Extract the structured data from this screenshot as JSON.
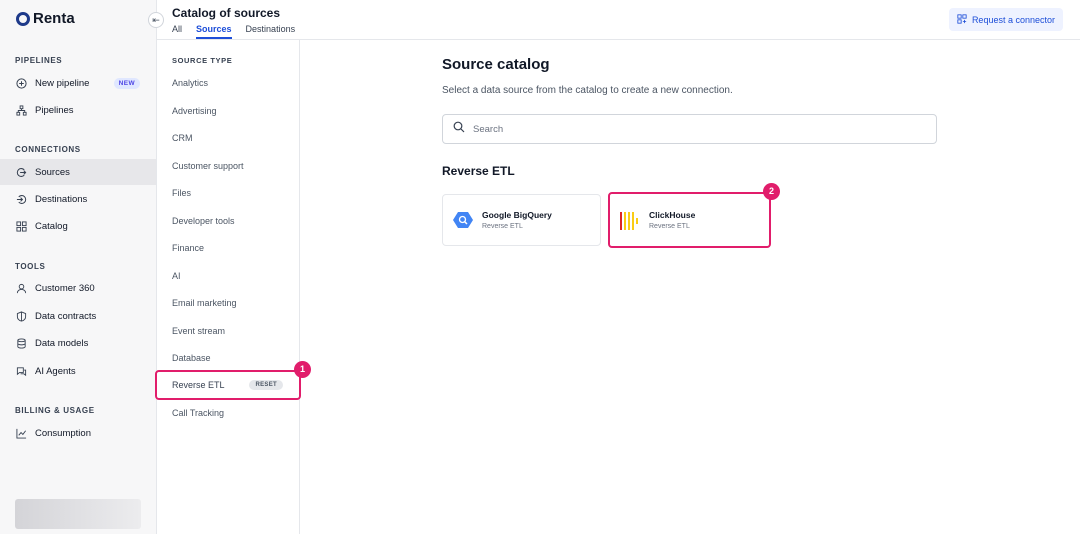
{
  "brand": {
    "name": "Renta"
  },
  "nav": {
    "sections": [
      {
        "label": "PIPELINES",
        "items": [
          {
            "label": "New pipeline",
            "icon": "plus-circle-icon",
            "badge": "NEW"
          },
          {
            "label": "Pipelines",
            "icon": "hierarchy-icon"
          }
        ]
      },
      {
        "label": "CONNECTIONS",
        "items": [
          {
            "label": "Sources",
            "icon": "source-in-icon",
            "active": true
          },
          {
            "label": "Destinations",
            "icon": "destination-out-icon"
          },
          {
            "label": "Catalog",
            "icon": "grid-icon"
          }
        ]
      },
      {
        "label": "TOOLS",
        "items": [
          {
            "label": "Customer 360",
            "icon": "user-icon"
          },
          {
            "label": "Data contracts",
            "icon": "shield-icon"
          },
          {
            "label": "Data models",
            "icon": "database-icon"
          },
          {
            "label": "AI Agents",
            "icon": "chat-icon"
          }
        ]
      },
      {
        "label": "BILLING & USAGE",
        "items": [
          {
            "label": "Consumption",
            "icon": "trend-chart-icon"
          }
        ]
      }
    ]
  },
  "header": {
    "title": "Catalog of sources",
    "tabs": [
      "All",
      "Sources",
      "Destinations"
    ],
    "active_tab": "Sources",
    "request_button": "Request a connector"
  },
  "filter": {
    "title": "SOURCE TYPE",
    "items": [
      "Analytics",
      "Advertising",
      "CRM",
      "Customer support",
      "Files",
      "Developer tools",
      "Finance",
      "AI",
      "Email marketing",
      "Event stream",
      "Database",
      "Reverse ETL",
      "Call Tracking"
    ],
    "selected": "Reverse ETL",
    "reset_label": "RESET"
  },
  "main": {
    "title": "Source catalog",
    "subtitle": "Select a data source from the catalog to create a new connection.",
    "search_placeholder": "Search",
    "group_title": "Reverse ETL",
    "cards": [
      {
        "name": "Google BigQuery",
        "category": "Reverse ETL",
        "icon": "bigquery-icon"
      },
      {
        "name": "ClickHouse",
        "category": "Reverse ETL",
        "icon": "clickhouse-icon"
      }
    ]
  },
  "annotations": {
    "step1": "1",
    "step2": "2"
  },
  "colors": {
    "accent": "#1d4ed8",
    "highlight": "#e11d6b",
    "clickhouse": "#facc15",
    "bigquery": "#4285f4"
  }
}
